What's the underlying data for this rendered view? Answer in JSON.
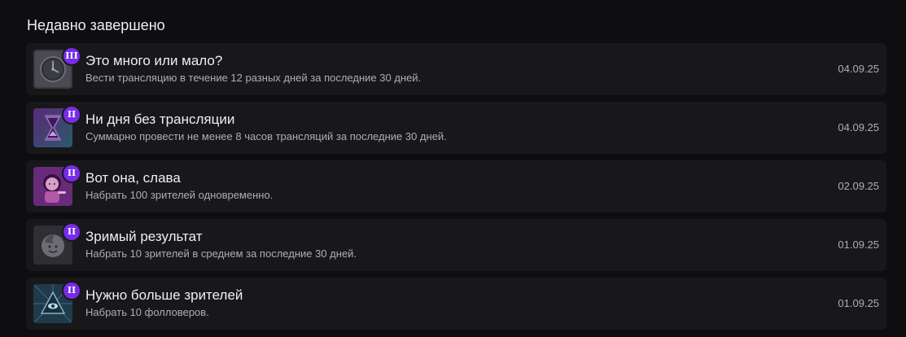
{
  "section": {
    "title": "Недавно завершено"
  },
  "achievements": [
    {
      "icon": "clock-icon",
      "tier": "III",
      "title": "Это много или мало?",
      "description": "Вести трансляцию в течение 12 разных дней за последние 30 дней.",
      "date": "04.09.25"
    },
    {
      "icon": "hourglass-icon",
      "tier": "II",
      "title": "Ни дня без трансляции",
      "description": "Суммарно провести не менее 8 часов трансляций за последние 30 дней.",
      "date": "04.09.25"
    },
    {
      "icon": "streamer-girl-icon",
      "tier": "II",
      "title": "Вот она, слава",
      "description": "Набрать 100 зрителей одновременно.",
      "date": "02.09.25"
    },
    {
      "icon": "face-icon",
      "tier": "II",
      "title": "Зримый результат",
      "description": "Набрать 10 зрителей в среднем за последние 30 дней.",
      "date": "01.09.25"
    },
    {
      "icon": "eye-pyramid-icon",
      "tier": "II",
      "title": "Нужно больше зрителей",
      "description": "Набрать 10 фолловеров.",
      "date": "01.09.25"
    }
  ]
}
